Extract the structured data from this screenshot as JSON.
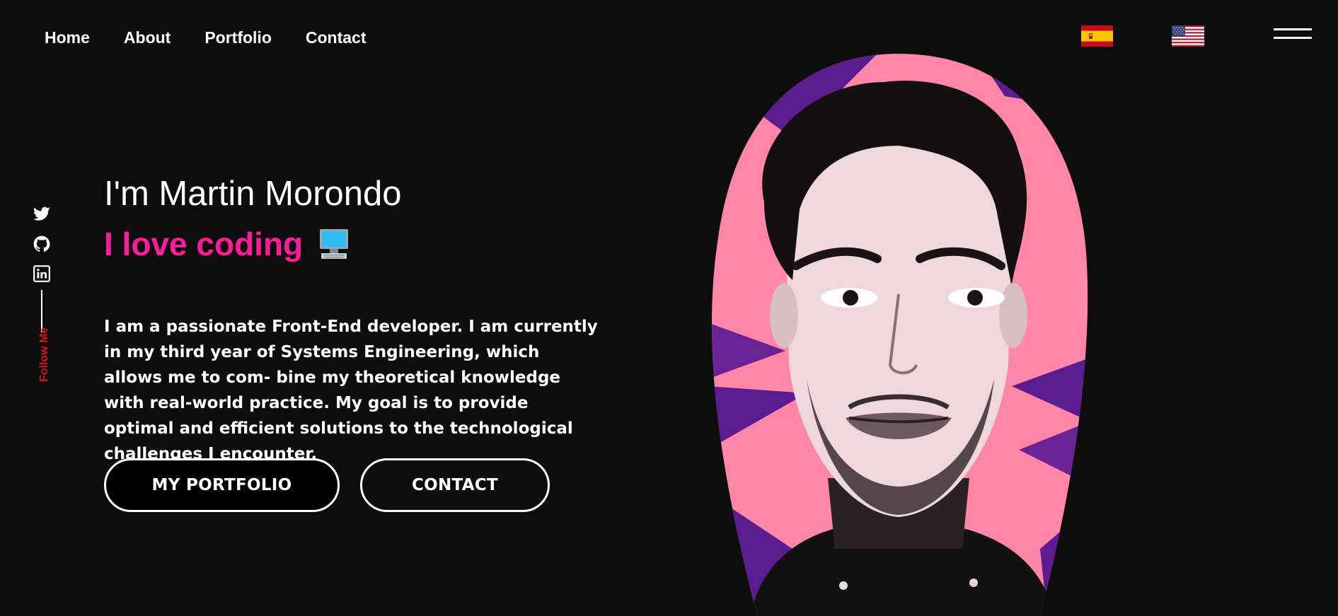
{
  "nav": {
    "items": [
      {
        "label": "Home"
      },
      {
        "label": "About"
      },
      {
        "label": "Portfolio"
      },
      {
        "label": "Contact"
      }
    ]
  },
  "languages": [
    {
      "icon": "spain-flag-icon"
    },
    {
      "icon": "usa-flag-icon"
    }
  ],
  "menu_icon": "hamburger-menu-icon",
  "social": {
    "icons": [
      "twitter-icon",
      "github-icon",
      "linkedin-icon"
    ],
    "follow_label": "Follow Me",
    "follow_color": "#e11216"
  },
  "hero": {
    "name": "I'm Martin Morondo",
    "tagline": "I love coding",
    "tagline_emoji_icon": "desktop-computer-icon",
    "tagline_color": "#ff1b9c",
    "description": "I am a passionate Front-End developer. I am currently in my third year of Systems Engineering, which allows me to com- bine my theoretical knowledge with real-world practice. My goal is to provide optimal and efficient solutions to the technological challenges I encounter.",
    "buttons": {
      "portfolio": "MY PORTFOLIO",
      "contact": "CONTACT"
    }
  },
  "portrait_icon": "profile-portrait-illustration",
  "colors": {
    "background": "#0d0d0d",
    "portrait_pink": "#ff86a8",
    "portrait_purple": "#5a1c8f"
  }
}
